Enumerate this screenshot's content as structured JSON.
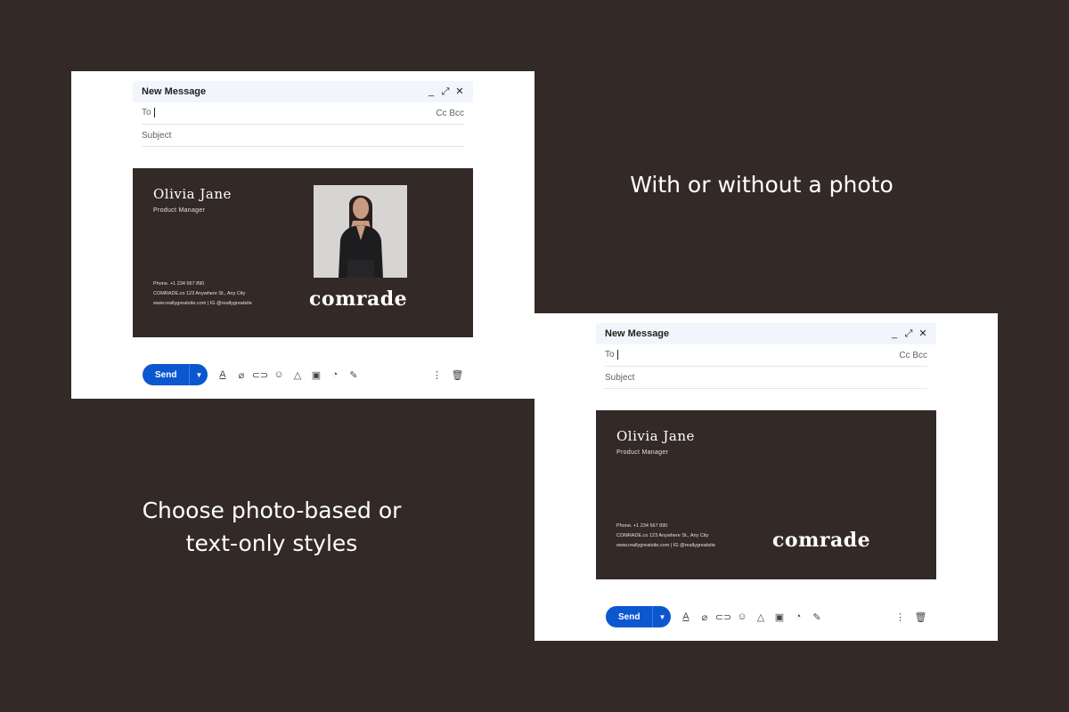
{
  "captions": {
    "with_or_without": "With or without a photo",
    "choose_line1": "Choose photo-based or",
    "choose_line2": "text-only styles"
  },
  "compose": {
    "title": "New Message",
    "to_label": "To",
    "cc_bcc": "Cc Bcc",
    "subject_label": "Subject",
    "send_label": "Send",
    "window_icons": [
      "minimize-icon",
      "expand-icon",
      "close-icon"
    ],
    "toolbar_icons": [
      "format-text-icon",
      "attach-icon",
      "link-icon",
      "emoji-icon",
      "drive-icon",
      "image-icon",
      "lock-clock-icon",
      "pen-icon",
      "more-icon",
      "trash-icon"
    ]
  },
  "signature": {
    "name": "Olivia Jane",
    "role": "Product Manager",
    "phone": "Phone. +1 234 567 890",
    "address": "COMRADE.co 123 Anywhere St., Any City",
    "web": "www.reallygreatsite.com | IG @reallygreatsite",
    "web_alt": "www.reallygreatsite.com | IG @reallygreatsite",
    "brand": "comrade"
  },
  "colors": {
    "background": "#332a28",
    "signature_bg": "#332a28",
    "send_button": "#0b57d0",
    "header_bg": "#f2f6fc"
  }
}
